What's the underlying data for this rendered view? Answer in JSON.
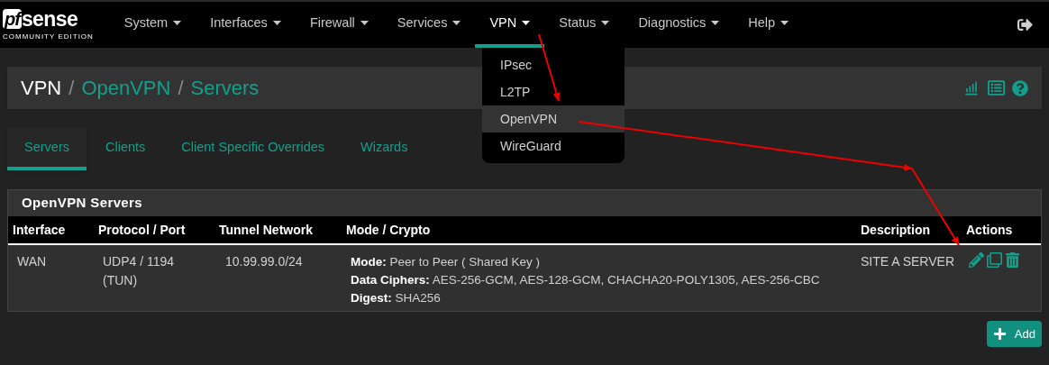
{
  "logo": {
    "mark": "pf",
    "word": "sense",
    "edition": "COMMUNITY EDITION"
  },
  "nav": [
    {
      "label": "System",
      "selected": false
    },
    {
      "label": "Interfaces",
      "selected": false
    },
    {
      "label": "Firewall",
      "selected": false
    },
    {
      "label": "Services",
      "selected": false
    },
    {
      "label": "VPN",
      "selected": true
    },
    {
      "label": "Status",
      "selected": false
    },
    {
      "label": "Diagnostics",
      "selected": false
    },
    {
      "label": "Help",
      "selected": false
    }
  ],
  "dropdown": [
    {
      "label": "IPsec",
      "selected": false
    },
    {
      "label": "L2TP",
      "selected": false
    },
    {
      "label": "OpenVPN",
      "selected": true
    },
    {
      "label": "WireGuard",
      "selected": false
    }
  ],
  "breadcrumb": [
    {
      "label": "VPN",
      "link": false
    },
    {
      "label": "OpenVPN",
      "link": true
    },
    {
      "label": "Servers",
      "link": true
    }
  ],
  "breadcrumb_separator": "/",
  "tabs": [
    {
      "label": "Servers",
      "selected": true
    },
    {
      "label": "Clients",
      "selected": false
    },
    {
      "label": "Client Specific Overrides",
      "selected": false
    },
    {
      "label": "Wizards",
      "selected": false
    }
  ],
  "panel": {
    "title": "OpenVPN Servers",
    "columns": [
      "Interface",
      "Protocol / Port",
      "Tunnel Network",
      "Mode / Crypto",
      "Description",
      "Actions"
    ],
    "rows": [
      {
        "interface": "WAN",
        "protocol": [
          "UDP4 / 1194",
          "(TUN)"
        ],
        "tunnel": "10.99.99.0/24",
        "crypto": [
          {
            "label": "Mode:",
            "value": "Peer to Peer ( Shared Key )"
          },
          {
            "label": "Data Ciphers:",
            "value": "AES-256-GCM, AES-128-GCM, CHACHA20-POLY1305, AES-256-CBC"
          },
          {
            "label": "Digest:",
            "value": "SHA256"
          }
        ],
        "description": "SITE A SERVER"
      }
    ]
  },
  "add_button": {
    "label": "Add"
  }
}
